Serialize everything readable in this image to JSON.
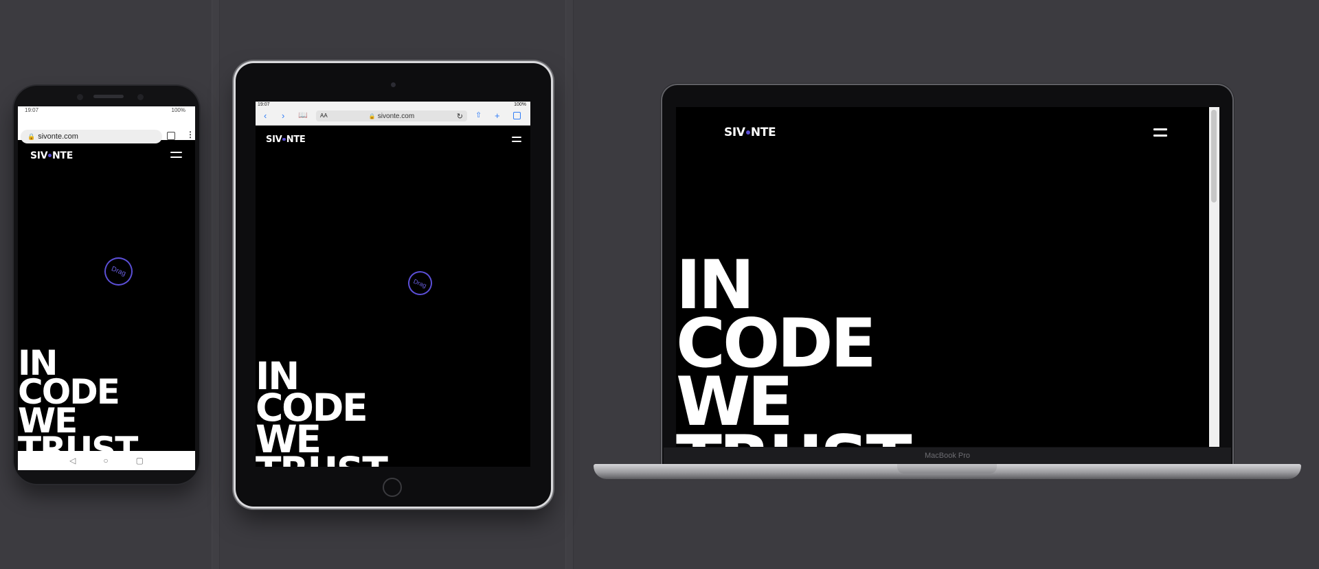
{
  "colors": {
    "accent": "#5b4fd6",
    "background": "#3c3b40",
    "screen": "#000000"
  },
  "brand": {
    "prefix": "SIV",
    "suffix": "NTE"
  },
  "hero_lines": [
    "IN",
    "CODE",
    "WE",
    "TRUST"
  ],
  "drag_label": "Drag",
  "menu_icon": "hamburger-menu-icon",
  "phone": {
    "time": "19:07",
    "battery": "100%",
    "url": "sivonte.com",
    "nav_icons": [
      "back-icon",
      "home-icon",
      "recents-icon"
    ]
  },
  "tablet": {
    "time": "19:07",
    "battery": "100%",
    "url": "sivonte.com",
    "text_size": "AA"
  },
  "laptop": {
    "model": "MacBook Pro"
  }
}
